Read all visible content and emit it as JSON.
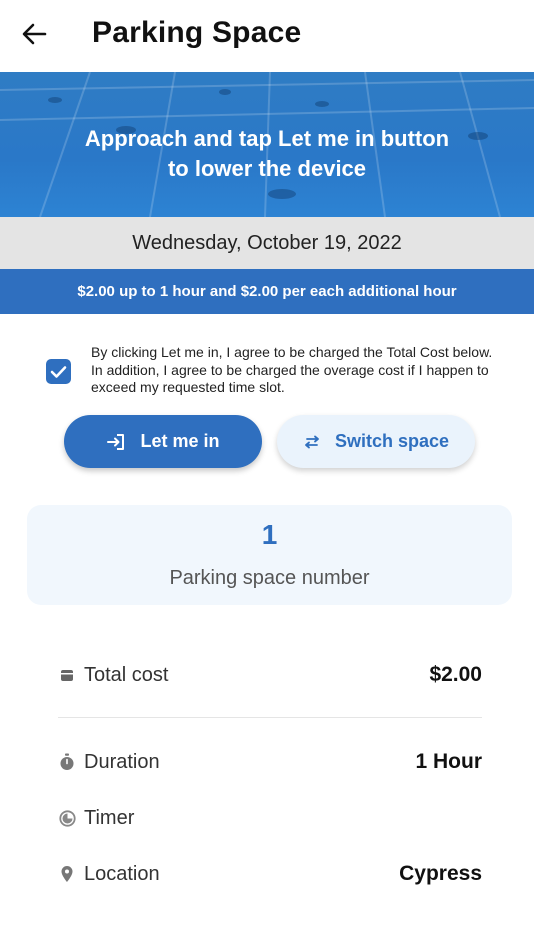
{
  "header": {
    "title": "Parking Space",
    "back_icon": "arrow-left-icon"
  },
  "banner": {
    "line1": "Approach and tap Let me in button",
    "line2": "to lower the device"
  },
  "date": "Wednesday, October 19, 2022",
  "pricing": "$2.00 up to 1 hour and $2.00 per each additional hour",
  "agreement": {
    "checked": true,
    "text": "By clicking Let me in, I agree to be charged the Total Cost below. In addition, I agree to be charged the overage cost if I happen to exceed my requested time slot."
  },
  "buttons": {
    "let_me_in": "Let me in",
    "switch_space": "Switch space"
  },
  "space": {
    "number": "1",
    "label": "Parking space number"
  },
  "details": {
    "total_cost_label": "Total cost",
    "total_cost_value": "$2.00",
    "duration_label": "Duration",
    "duration_value": "1 Hour",
    "timer_label": "Timer",
    "timer_value": "",
    "location_label": "Location",
    "location_value": "Cypress"
  },
  "colors": {
    "primary": "#2f6fbf",
    "banner": "#2a78c8",
    "date_bg": "#e4e4e4",
    "card_bg": "#f1f7fd"
  }
}
